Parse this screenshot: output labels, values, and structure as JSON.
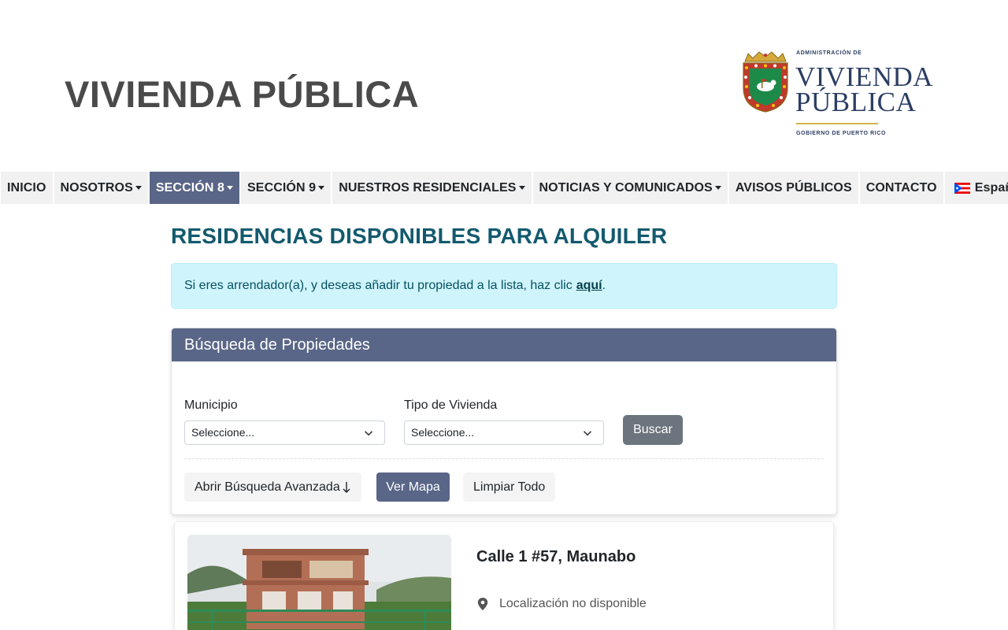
{
  "header": {
    "site_title": "VIVIENDA PÚBLICA",
    "logo": {
      "top_text": "ADMINISTRACIÓN DE",
      "line1": "VIVIENDA",
      "line2": "PÚBLICA",
      "bottom_text": "GOBIERNO DE PUERTO RICO"
    }
  },
  "nav": {
    "items": [
      {
        "label": "INICIO",
        "dropdown": false,
        "active": false
      },
      {
        "label": "NOSOTROS",
        "dropdown": true,
        "active": false
      },
      {
        "label": "SECCIÓN 8",
        "dropdown": true,
        "active": true
      },
      {
        "label": "SECCIÓN 9",
        "dropdown": true,
        "active": false
      },
      {
        "label": "NUESTROS RESIDENCIALES",
        "dropdown": true,
        "active": false
      },
      {
        "label": "NOTICIAS Y COMUNICADOS",
        "dropdown": true,
        "active": false
      },
      {
        "label": "AVISOS PÚBLICOS",
        "dropdown": false,
        "active": false
      },
      {
        "label": "CONTACTO",
        "dropdown": false,
        "active": false
      }
    ],
    "language": "Españ"
  },
  "main": {
    "title": "RESIDENCIAS DISPONIBLES PARA ALQUILER",
    "alert": {
      "text": "Si eres arrendador(a), y deseas añadir tu propiedad a la lista, haz clic",
      "link": "aquí",
      "suffix": "."
    },
    "search": {
      "header": "Búsqueda de Propiedades",
      "municipio_label": "Municipio",
      "municipio_value": "Seleccione...",
      "tipo_label": "Tipo de Vivienda",
      "tipo_value": "Seleccione...",
      "buscar": "Buscar",
      "advanced": "Abrir Búsqueda Avanzada",
      "map": "Ver Mapa",
      "clear": "Limpiar Todo"
    },
    "listing": {
      "title": "Calle 1 #57, Maunabo",
      "location": "Localización no disponible"
    }
  },
  "colors": {
    "nav_active": "#5a6687",
    "title_teal": "#135a6e",
    "alert_bg": "#cff4fc"
  }
}
